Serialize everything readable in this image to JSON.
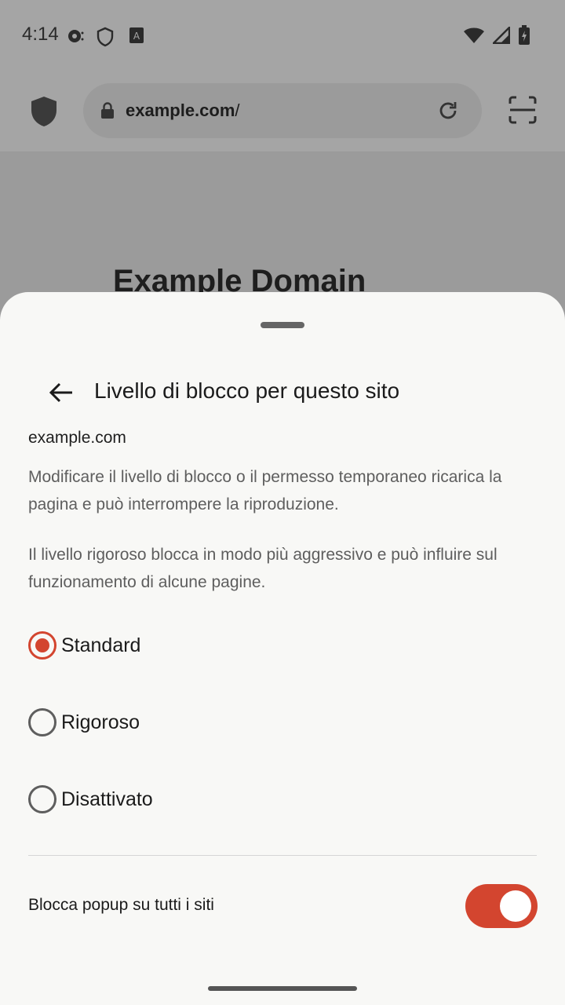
{
  "status": {
    "time": "4:14"
  },
  "toolbar": {
    "url_host": "example.com",
    "url_path": "/"
  },
  "page": {
    "title": "Example Domain"
  },
  "sheet": {
    "title": "Livello di blocco per questo sito",
    "site": "example.com",
    "desc1": "Modificare il livello di blocco o il permesso temporaneo ricarica la pagina e può interrompere la riproduzione.",
    "desc2": "Il livello rigoroso blocca in modo più aggressivo e può influire sul funzionamento di alcune pagine.",
    "options": [
      {
        "label": "Standard",
        "checked": true
      },
      {
        "label": "Rigoroso",
        "checked": false
      },
      {
        "label": "Disattivato",
        "checked": false
      }
    ],
    "popup_label": "Blocca popup su tutti i siti",
    "popup_enabled": true
  },
  "colors": {
    "accent": "#d3452f"
  }
}
